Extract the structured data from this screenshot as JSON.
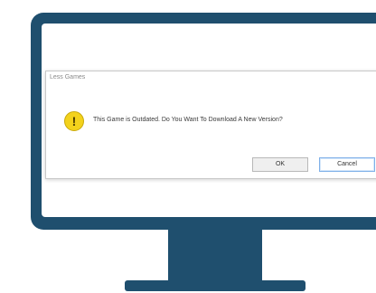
{
  "dialog": {
    "title": "Less Games",
    "close_glyph": "×",
    "icon": "warning-icon",
    "icon_glyph": "!",
    "message": "This Game is Outdated. Do You Want To Download A New Version?",
    "ok_label": "OK",
    "cancel_label": "Cancel"
  },
  "colors": {
    "monitor": "#1f4f6e",
    "warning": "#f3d21c",
    "focus_border": "#7fb0e8"
  }
}
